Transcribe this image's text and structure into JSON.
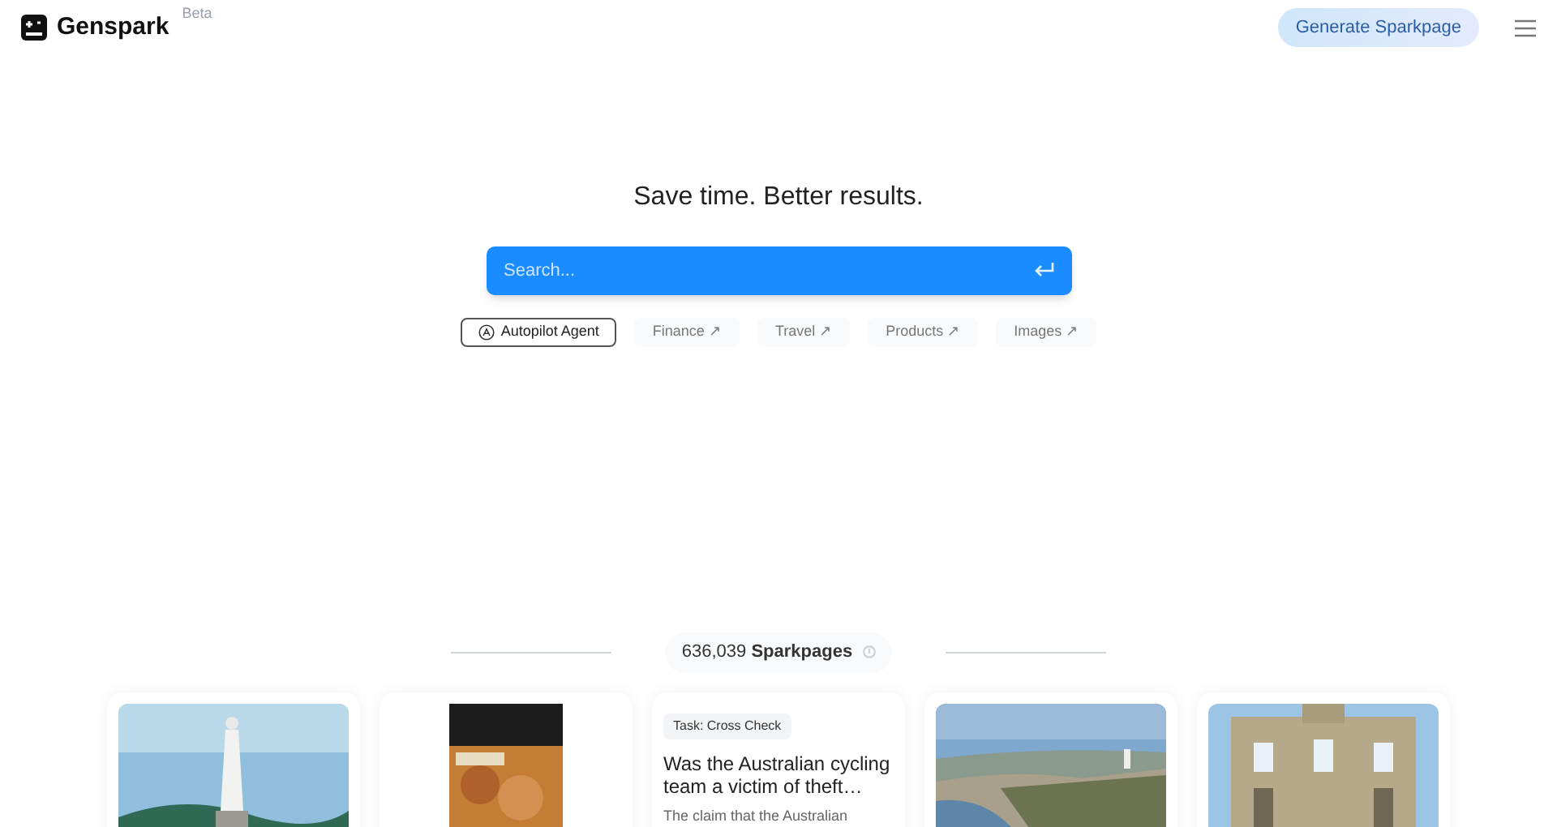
{
  "header": {
    "brand": "Genspark",
    "badge": "Beta",
    "cta": "Generate Sparkpage"
  },
  "hero": {
    "title": "Save time. Better results.",
    "search": {
      "placeholder": "Search..."
    },
    "chips": [
      {
        "kind": "agent",
        "label": "Autopilot Agent"
      },
      {
        "kind": "link",
        "label": "Finance",
        "arrow": "↗"
      },
      {
        "kind": "link",
        "label": "Travel",
        "arrow": "↗"
      },
      {
        "kind": "link",
        "label": "Products",
        "arrow": "↗"
      },
      {
        "kind": "link",
        "label": "Images",
        "arrow": "↗"
      }
    ]
  },
  "sparkpages": {
    "count": "636,039",
    "label": "Sparkpages",
    "cards": [
      {
        "kind": "picture"
      },
      {
        "kind": "picture"
      },
      {
        "kind": "text",
        "tag": "Task: Cross Check",
        "title": "Was the Australian cycling team a victim of theft…",
        "snippet": "The claim that the Australian"
      },
      {
        "kind": "picture"
      },
      {
        "kind": "picture"
      }
    ]
  }
}
